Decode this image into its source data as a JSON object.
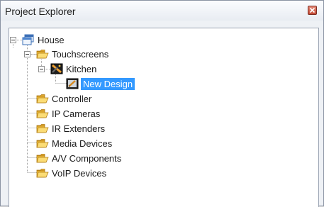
{
  "panel": {
    "title": "Project Explorer",
    "close_icon": "close-icon"
  },
  "tree": {
    "root": {
      "label": "House",
      "icon": "house-window-icon",
      "expanded": true
    },
    "touchscreens": {
      "label": "Touchscreens",
      "icon": "folder-icon",
      "expanded": true
    },
    "kitchen": {
      "label": "Kitchen",
      "icon": "touchscreen-device-icon",
      "expanded": true
    },
    "new_design": {
      "label": "New Design",
      "icon": "design-icon",
      "selected": true
    },
    "folders": [
      {
        "label": "Controller",
        "icon": "folder-icon"
      },
      {
        "label": "IP Cameras",
        "icon": "folder-icon"
      },
      {
        "label": "IR Extenders",
        "icon": "folder-icon"
      },
      {
        "label": "Media Devices",
        "icon": "folder-icon"
      },
      {
        "label": "A/V Components",
        "icon": "folder-icon"
      },
      {
        "label": "VoIP Devices",
        "icon": "folder-icon"
      }
    ]
  },
  "colors": {
    "selection": "#3399ff",
    "folder": "#f5c542",
    "close": "#c44b36"
  }
}
